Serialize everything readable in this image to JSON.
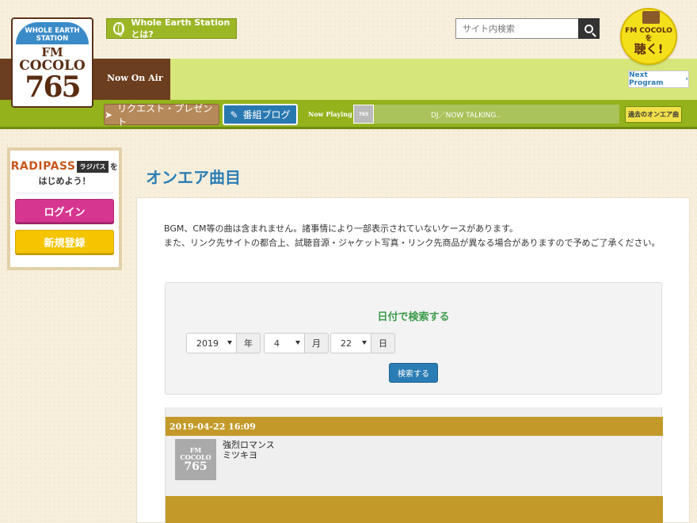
{
  "header": {
    "logo_arc": "WHOLE EARTH STATION",
    "logo_fm": "FM",
    "logo_cocolo": "COCOLO",
    "logo_num": "765",
    "about_label": "Whole Earth Stationとは?",
    "search_placeholder": "サイト内検索",
    "listen_line1": "FM COCOLOを",
    "listen_line2": "聴く!",
    "now_on_air": "Now On Air",
    "next_program": "Next Program"
  },
  "playing_bar": {
    "request_label": "リクエスト・プレゼント",
    "blog_label": "番組ブログ",
    "now_playing_label": "Now Playing",
    "thumb_text": "765",
    "track": "DJ／NOW TALKING..",
    "past_label": "過去のオンエア曲"
  },
  "sidebar": {
    "radipass": "RADIPASS",
    "radipass_box": "ラジパス",
    "radipass_wo": "を",
    "tagline": "はじめよう！",
    "login_label": "ログイン",
    "register_label": "新規登録"
  },
  "main": {
    "page_title": "オンエア曲目",
    "notice_line1": "BGM、CM等の曲は含まれません。諸事情により一部表示されていないケースがあります。",
    "notice_line2": "また、リンク先サイトの都合上、試聴音源・ジャケット写真・リンク先商品が異なる場合がありますので予めご了承ください。",
    "search": {
      "title": "日付で検索する",
      "year_value": "2019",
      "year_unit": "年",
      "month_value": "4",
      "month_unit": "月",
      "day_value": "22",
      "day_unit": "日",
      "submit_label": "検索する"
    },
    "results": [
      {
        "datetime": "2019-04-22 16:09",
        "thumb_fm": "FM",
        "thumb_cocolo": "COCOLO",
        "thumb_num": "765",
        "title": "強烈ロマンス",
        "artist": "ミツキヨ"
      }
    ]
  },
  "colors": {
    "brand_brown": "#6a3e1e",
    "brand_green": "#93b21c",
    "title_blue": "#2b7db5",
    "result_gold": "#c39a2a",
    "login_pink": "#d6368f",
    "register_yellow": "#f4c500"
  }
}
